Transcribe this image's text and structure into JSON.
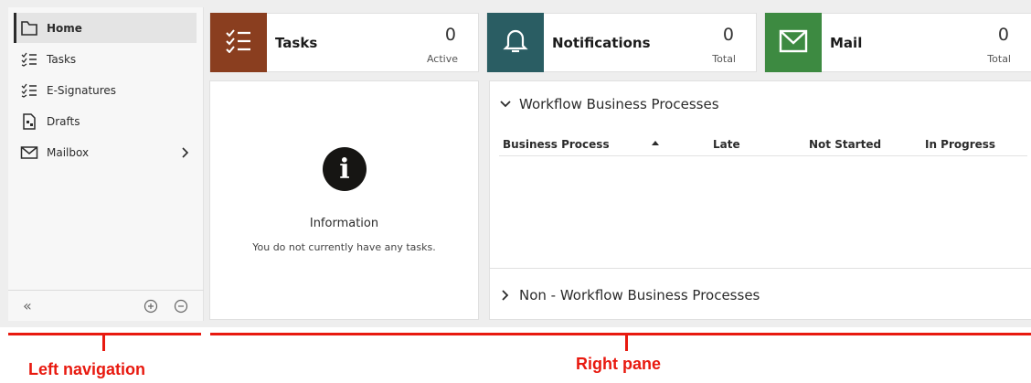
{
  "nav": {
    "items": [
      {
        "label": "Home",
        "icon": "home-icon"
      },
      {
        "label": "Tasks",
        "icon": "checklist-icon"
      },
      {
        "label": "E-Signatures",
        "icon": "checklist-icon"
      },
      {
        "label": "Drafts",
        "icon": "draft-document-icon"
      },
      {
        "label": "Mailbox",
        "icon": "mail-icon"
      }
    ],
    "collapse_label": "«"
  },
  "cards": [
    {
      "name": "Tasks",
      "count": "0",
      "sub": "Active",
      "color": "#8a3e1f"
    },
    {
      "name": "Notifications",
      "count": "0",
      "sub": "Total",
      "color": "#2a5d63"
    },
    {
      "name": "Mail",
      "count": "0",
      "sub": "Total",
      "color": "#3d8a41"
    }
  ],
  "info": {
    "title": "Information",
    "message": "You do not currently have any tasks."
  },
  "workflow": {
    "title": "Workflow Business Processes",
    "columns": [
      "Business Process",
      "Late",
      "Not Started",
      "In Progress"
    ],
    "non_workflow_title": "Non - Workflow Business Processes"
  },
  "annotations": {
    "left": "Left navigation",
    "right": "Right pane",
    "color": "#e8190f"
  }
}
